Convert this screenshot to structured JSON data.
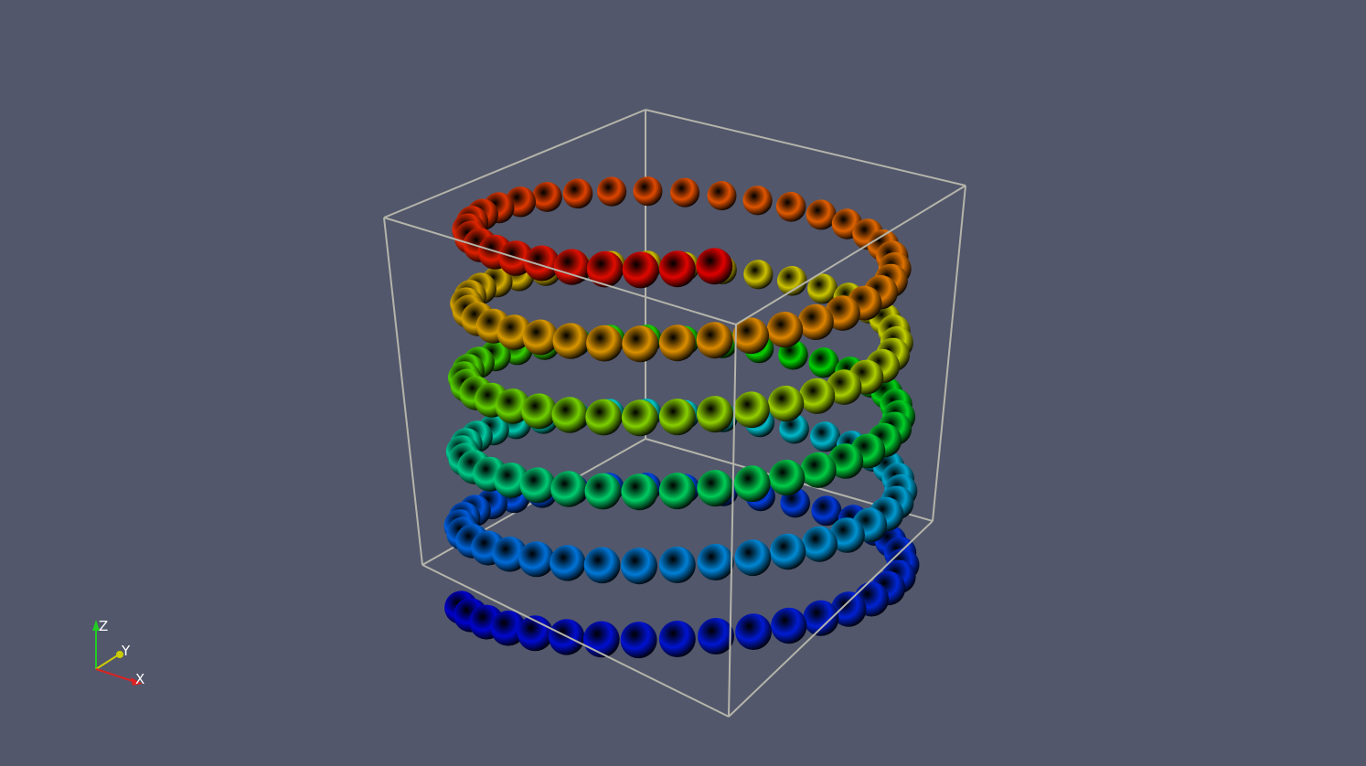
{
  "viewport": {
    "background": "#52576b",
    "outline_color": "#b4b4aa"
  },
  "helix": {
    "turns": 5.25,
    "sphere_count": 190,
    "colormap": "rainbow",
    "color_stops": [
      "#0000cc",
      "#0050e0",
      "#00c8c8",
      "#00d000",
      "#c8d000",
      "#e08000",
      "#e00000"
    ]
  },
  "orientation_axes": {
    "z": {
      "label": "Z",
      "color": "#22cc22"
    },
    "y": {
      "label": "Y",
      "color": "#cccc00"
    },
    "x": {
      "label": "X",
      "color": "#dd2222"
    }
  }
}
